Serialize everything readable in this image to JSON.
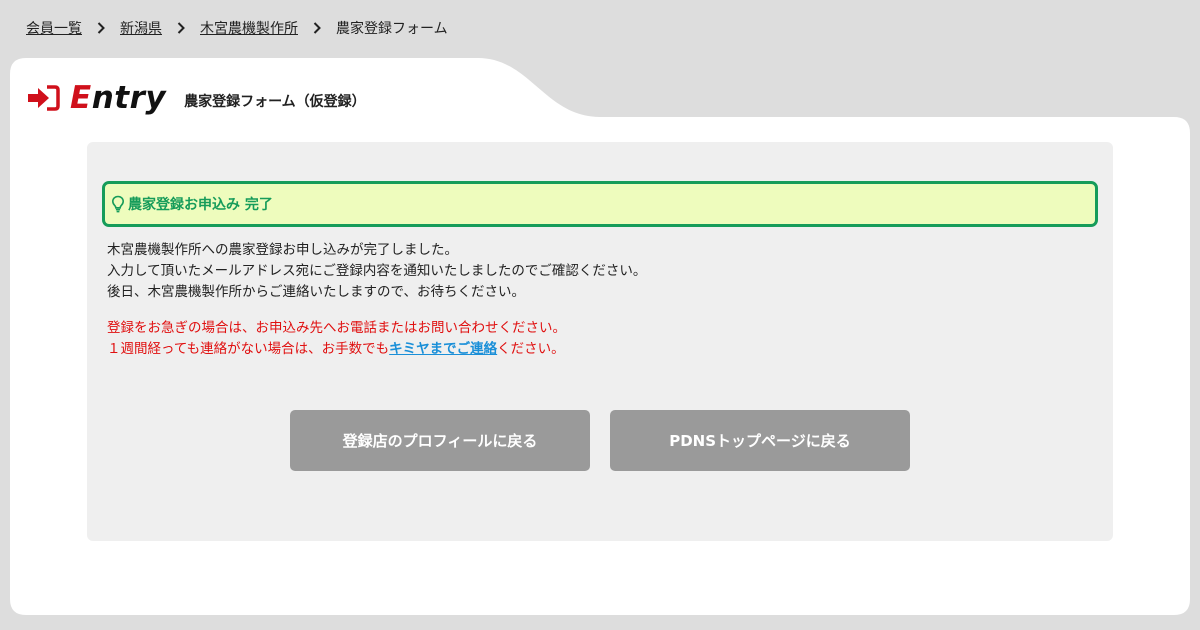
{
  "breadcrumb": {
    "items": [
      {
        "label": "会員一覧"
      },
      {
        "label": "新潟県"
      },
      {
        "label": "木宮農機製作所"
      }
    ],
    "current": "農家登録フォーム"
  },
  "header": {
    "entry_first": "E",
    "entry_rest": "ntry",
    "subtitle": "農家登録フォーム（仮登録）",
    "icon": "sign-in-icon"
  },
  "notice": {
    "icon": "lightbulb-icon",
    "title": "農家登録お申込み 完了"
  },
  "message": {
    "line1": "木宮農機製作所への農家登録お申し込みが完了しました。",
    "line2": "入力して頂いたメールアドレス宛にご登録内容を通知いたしましたのでご確認ください。",
    "line3": "後日、木宮農機製作所からご連絡いたしますので、お待ちください。"
  },
  "warning": {
    "line1": "登録をお急ぎの場合は、お申込み先へお電話またはお問い合わせください。",
    "line2_pre": "１週間経っても連絡がない場合は、お手数でも",
    "line2_link": "キミヤまでご連絡",
    "line2_post": "ください。"
  },
  "buttons": {
    "profile": "登録店のプロフィールに戻る",
    "top": "PDNSトップページに戻る"
  },
  "colors": {
    "page_bg": "#dddddd",
    "card_bg": "#ffffff",
    "panel_bg": "#efefef",
    "brand_red": "#d0101b",
    "notice_green": "#169c5a",
    "notice_bg": "#eefcbd",
    "warning_red": "#e01010",
    "link_blue": "#1a8fd8",
    "button_gray": "#9a9a9a"
  }
}
